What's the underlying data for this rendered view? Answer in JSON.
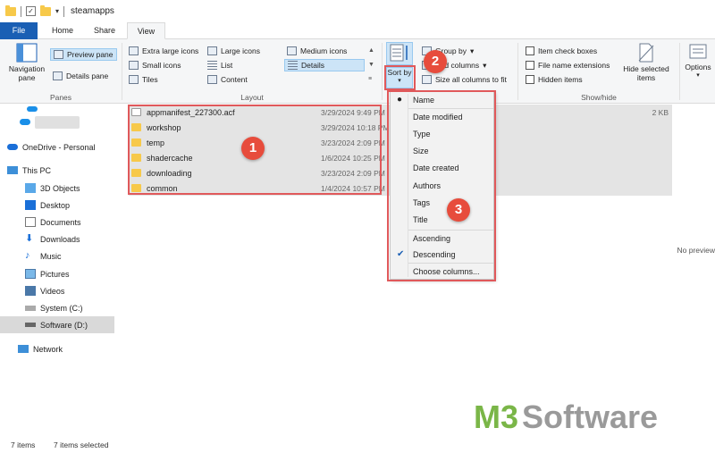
{
  "window": {
    "title": "steamapps"
  },
  "tabs": [
    "File",
    "Home",
    "Share",
    "View"
  ],
  "ribbon": {
    "panes": {
      "navigation_pane": "Navigation pane",
      "preview_pane": "Preview pane",
      "details_pane": "Details pane",
      "label": "Panes"
    },
    "layout": {
      "items": [
        "Extra large icons",
        "Large icons",
        "Medium icons",
        "Small icons",
        "List",
        "Details",
        "Tiles",
        "Content"
      ],
      "selected": "Details",
      "label": "Layout"
    },
    "current_view": {
      "sort_by": "Sort by",
      "group_by": "Group by",
      "add_columns": "Add columns",
      "size_all": "Size all columns to fit"
    },
    "show_hide": {
      "checkboxes": [
        "Item check boxes",
        "File name extensions",
        "Hidden items"
      ],
      "hide_selected": "Hide selected items",
      "label": "Show/hide"
    },
    "options": "Options"
  },
  "nav": [
    {
      "label": "",
      "icon": "cloud-icon"
    },
    {
      "label": "OneDrive - Personal",
      "icon": "cloud-icon"
    },
    {
      "label": "This PC",
      "icon": "computer-icon"
    },
    {
      "label": "3D Objects",
      "icon": "cube-icon"
    },
    {
      "label": "Desktop",
      "icon": "desktop-icon"
    },
    {
      "label": "Documents",
      "icon": "documents-icon"
    },
    {
      "label": "Downloads",
      "icon": "download-icon"
    },
    {
      "label": "Music",
      "icon": "music-icon"
    },
    {
      "label": "Pictures",
      "icon": "pictures-icon"
    },
    {
      "label": "Videos",
      "icon": "videos-icon"
    },
    {
      "label": "System (C:)",
      "icon": "drive-icon"
    },
    {
      "label": "Software (D:)",
      "icon": "drive-icon"
    },
    {
      "label": "Network",
      "icon": "network-icon"
    }
  ],
  "files": [
    {
      "name": "appmanifest_227300.acf",
      "date": "3/29/2024 9:49 PM",
      "size": "2 KB",
      "type": "file"
    },
    {
      "name": "workshop",
      "date": "3/29/2024 10:18 PM",
      "size": "",
      "type": "folder"
    },
    {
      "name": "temp",
      "date": "3/23/2024 2:09 PM",
      "size": "",
      "type": "folder"
    },
    {
      "name": "shadercache",
      "date": "1/6/2024 10:25 PM",
      "size": "",
      "type": "folder"
    },
    {
      "name": "downloading",
      "date": "3/23/2024 2:09 PM",
      "size": "",
      "type": "folder"
    },
    {
      "name": "common",
      "date": "1/4/2024 10:57 PM",
      "size": "",
      "type": "folder"
    }
  ],
  "sort_menu": {
    "items": [
      "Name",
      "Date modified",
      "Type",
      "Size",
      "Date created",
      "Authors",
      "Tags",
      "Title"
    ],
    "selected": "Name",
    "order": [
      "Ascending",
      "Descending"
    ],
    "order_selected": "Descending",
    "choose_columns": "Choose columns..."
  },
  "preview": "No preview",
  "badges": [
    "1",
    "2",
    "3"
  ],
  "status": {
    "count": "7 items",
    "selected": "7 items selected"
  },
  "watermark": {
    "m3": "M3",
    "software": "Software"
  },
  "colors": {
    "accent": "#1a5fb4",
    "highlight": "#e0595b",
    "badge": "#e74c3c",
    "watermark_green": "#7ab648"
  }
}
